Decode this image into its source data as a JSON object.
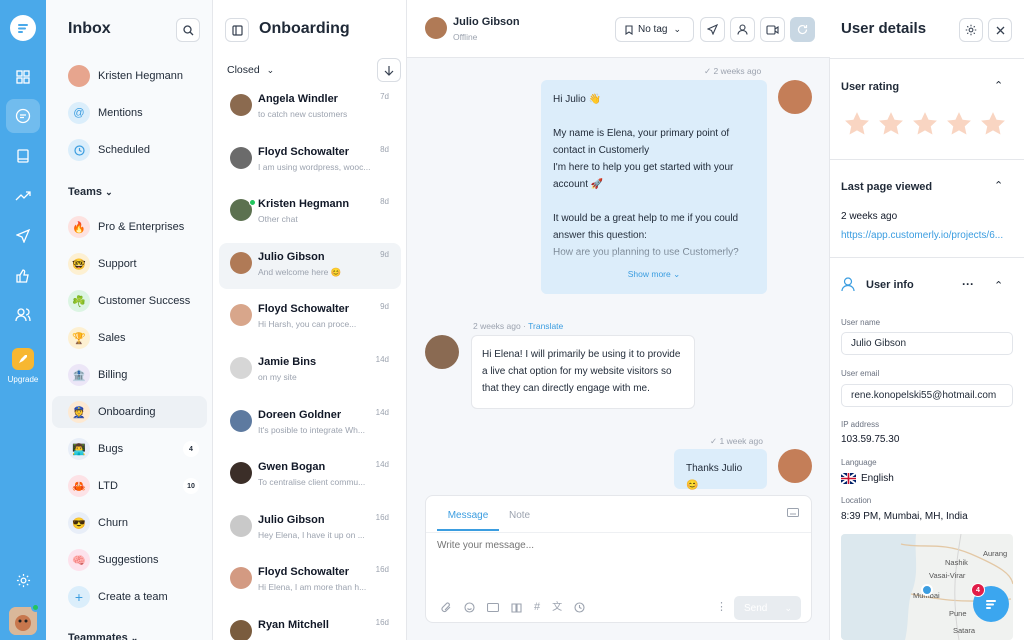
{
  "rail": {
    "items": [
      "home-icon",
      "chat-icon",
      "book-icon",
      "trend-icon",
      "send-icon",
      "thumbs-up-icon",
      "users-icon"
    ],
    "upgrade_label": "Upgrade"
  },
  "inbox": {
    "title": "Inbox",
    "items": [
      {
        "label": "Kristen Hegmann"
      },
      {
        "label": "Mentions"
      },
      {
        "label": "Scheduled"
      }
    ],
    "teams_label": "Teams",
    "teams": [
      {
        "label": "Pro & Enterprises",
        "emoji": "🔥"
      },
      {
        "label": "Support",
        "emoji": "🤓"
      },
      {
        "label": "Customer Success",
        "emoji": "☘️"
      },
      {
        "label": "Sales",
        "emoji": "🏆"
      },
      {
        "label": "Billing",
        "emoji": "🏦"
      },
      {
        "label": "Onboarding",
        "emoji": "👮"
      },
      {
        "label": "Bugs",
        "emoji": "👨‍💻",
        "count": "4"
      },
      {
        "label": "LTD",
        "emoji": "🦀",
        "count": "10"
      },
      {
        "label": "Churn",
        "emoji": "😎"
      },
      {
        "label": "Suggestions",
        "emoji": "🧠"
      }
    ],
    "create_team": "Create a team",
    "teammates_label": "Teammates"
  },
  "onboarding": {
    "title": "Onboarding",
    "filter": "Closed",
    "conversations": [
      {
        "name": "Angela Windler",
        "preview": "to catch new customers",
        "time": "7d"
      },
      {
        "name": "Floyd Schowalter",
        "preview": "I am using wordpress, wooc...",
        "time": "8d"
      },
      {
        "name": "Kristen Hegmann",
        "preview": "Other chat",
        "time": "8d"
      },
      {
        "name": "Julio Gibson",
        "preview": "And welcome here 😊",
        "time": "9d"
      },
      {
        "name": "Floyd Schowalter",
        "preview": "Hi Harsh, you can proce...",
        "time": "9d"
      },
      {
        "name": "Jamie Bins",
        "preview": "on my site",
        "time": "14d"
      },
      {
        "name": "Doreen Goldner",
        "preview": "It's posible to integrate Wh...",
        "time": "14d"
      },
      {
        "name": "Gwen Bogan",
        "preview": "To centralise client commu...",
        "time": "14d"
      },
      {
        "name": "Julio Gibson",
        "preview": "Hey Elena, I have it up on ...",
        "time": "16d"
      },
      {
        "name": "Floyd Schowalter",
        "preview": "Hi Elena, I am more than h...",
        "time": "16d"
      },
      {
        "name": "Ryan Mitchell",
        "preview": "",
        "time": "16d"
      }
    ]
  },
  "chat": {
    "contact_name": "Julio Gibson",
    "contact_status": "Offline",
    "tag_label": "No tag",
    "msg1_time": "2 weeks ago",
    "msg1_lines": [
      "Hi Julio 👋",
      "",
      "My name is Elena, your primary point of",
      "contact in Customerly",
      "I'm here to help you get started with your",
      "account 🚀",
      "",
      "It would be a great help to me if you could",
      "answer this question:",
      "How are you planning to use Customerly?"
    ],
    "show_more": "Show more",
    "msg2_time": "2 weeks ago",
    "translate": "Translate",
    "msg2_lines": [
      "Hi Elena! I will primarily be using it to provide",
      "a live chat option for my website visitors so",
      "that they can directly engage with me."
    ],
    "msg3_time": "1 week ago",
    "msg3_text": "Thanks Julio 😊",
    "tab_message": "Message",
    "tab_note": "Note",
    "placeholder": "Write your message...",
    "send": "Send"
  },
  "details": {
    "title": "User details",
    "rating_label": "User rating",
    "rating_value": 0,
    "last_page_label": "Last page viewed",
    "last_page_time": "2 weeks ago",
    "last_page_url": "https://app.customerly.io/projects/6...",
    "user_info_label": "User info",
    "username_label": "User name",
    "username": "Julio Gibson",
    "email_label": "User email",
    "email": "rene.konopelski55@hotmail.com",
    "ip_label": "IP address",
    "ip": "103.59.75.30",
    "language_label": "Language",
    "language": "English",
    "location_label": "Location",
    "location": "8:39 PM, Mumbai, MH, India",
    "map_labels": [
      "Aurang",
      "Nashik",
      "Vasai-Virar",
      "Mumbai",
      "Pune",
      "Satara"
    ],
    "chat_badge": "4"
  },
  "colors": {
    "rail": "#4aa9ea",
    "accent": "#3b9de0",
    "agent_bubble": "#dcedfa",
    "star": "#f9d5c2"
  }
}
